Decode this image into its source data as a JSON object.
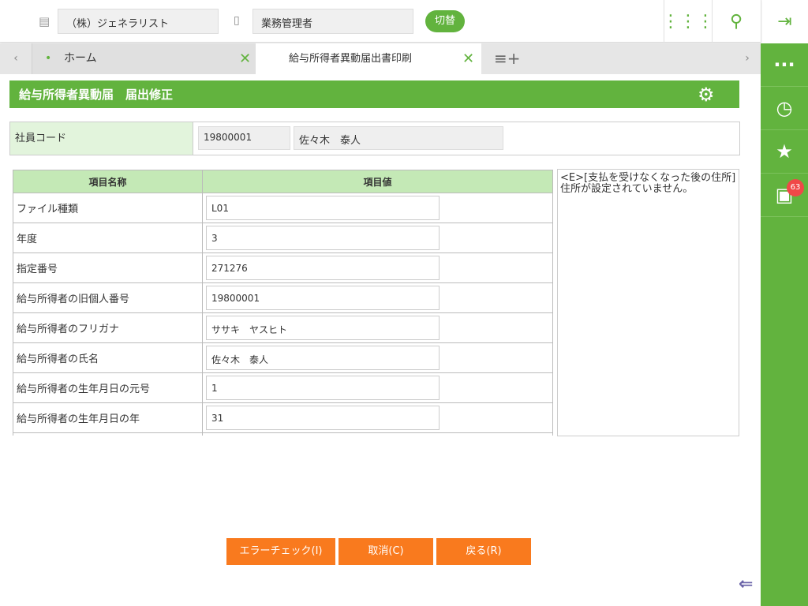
{
  "header": {
    "company": "（株）ジェネラリスト",
    "role": "業務管理者",
    "switch_label": "切替"
  },
  "tabs": [
    {
      "label": "ホーム"
    },
    {
      "label": "給与所得者異動届出書印刷"
    }
  ],
  "sidebar": {
    "badge_count": "63"
  },
  "page_title": "給与所得者異動届　届出修正",
  "employee": {
    "label": "社員コード",
    "code": "19800001",
    "name": "佐々木　泰人"
  },
  "table": {
    "headers": [
      "項目名称",
      "項目値"
    ],
    "rows": [
      {
        "name": "ファイル種類",
        "value": "L01"
      },
      {
        "name": "年度",
        "value": "3"
      },
      {
        "name": "指定番号",
        "value": "271276"
      },
      {
        "name": "給与所得者の旧個人番号",
        "value": "19800001"
      },
      {
        "name": "給与所得者のフリガナ",
        "value": "ササキ　ヤスヒト"
      },
      {
        "name": "給与所得者の氏名",
        "value": "佐々木　泰人"
      },
      {
        "name": "給与所得者の生年月日の元号",
        "value": "1"
      },
      {
        "name": "給与所得者の生年月日の年",
        "value": "31"
      }
    ]
  },
  "message": "<E>[支払を受けなくなった後の住所]住所が設定されていません。",
  "buttons": {
    "error_check": "エラーチェック(I)",
    "cancel": "取消(C)",
    "back": "戻る(R)"
  }
}
